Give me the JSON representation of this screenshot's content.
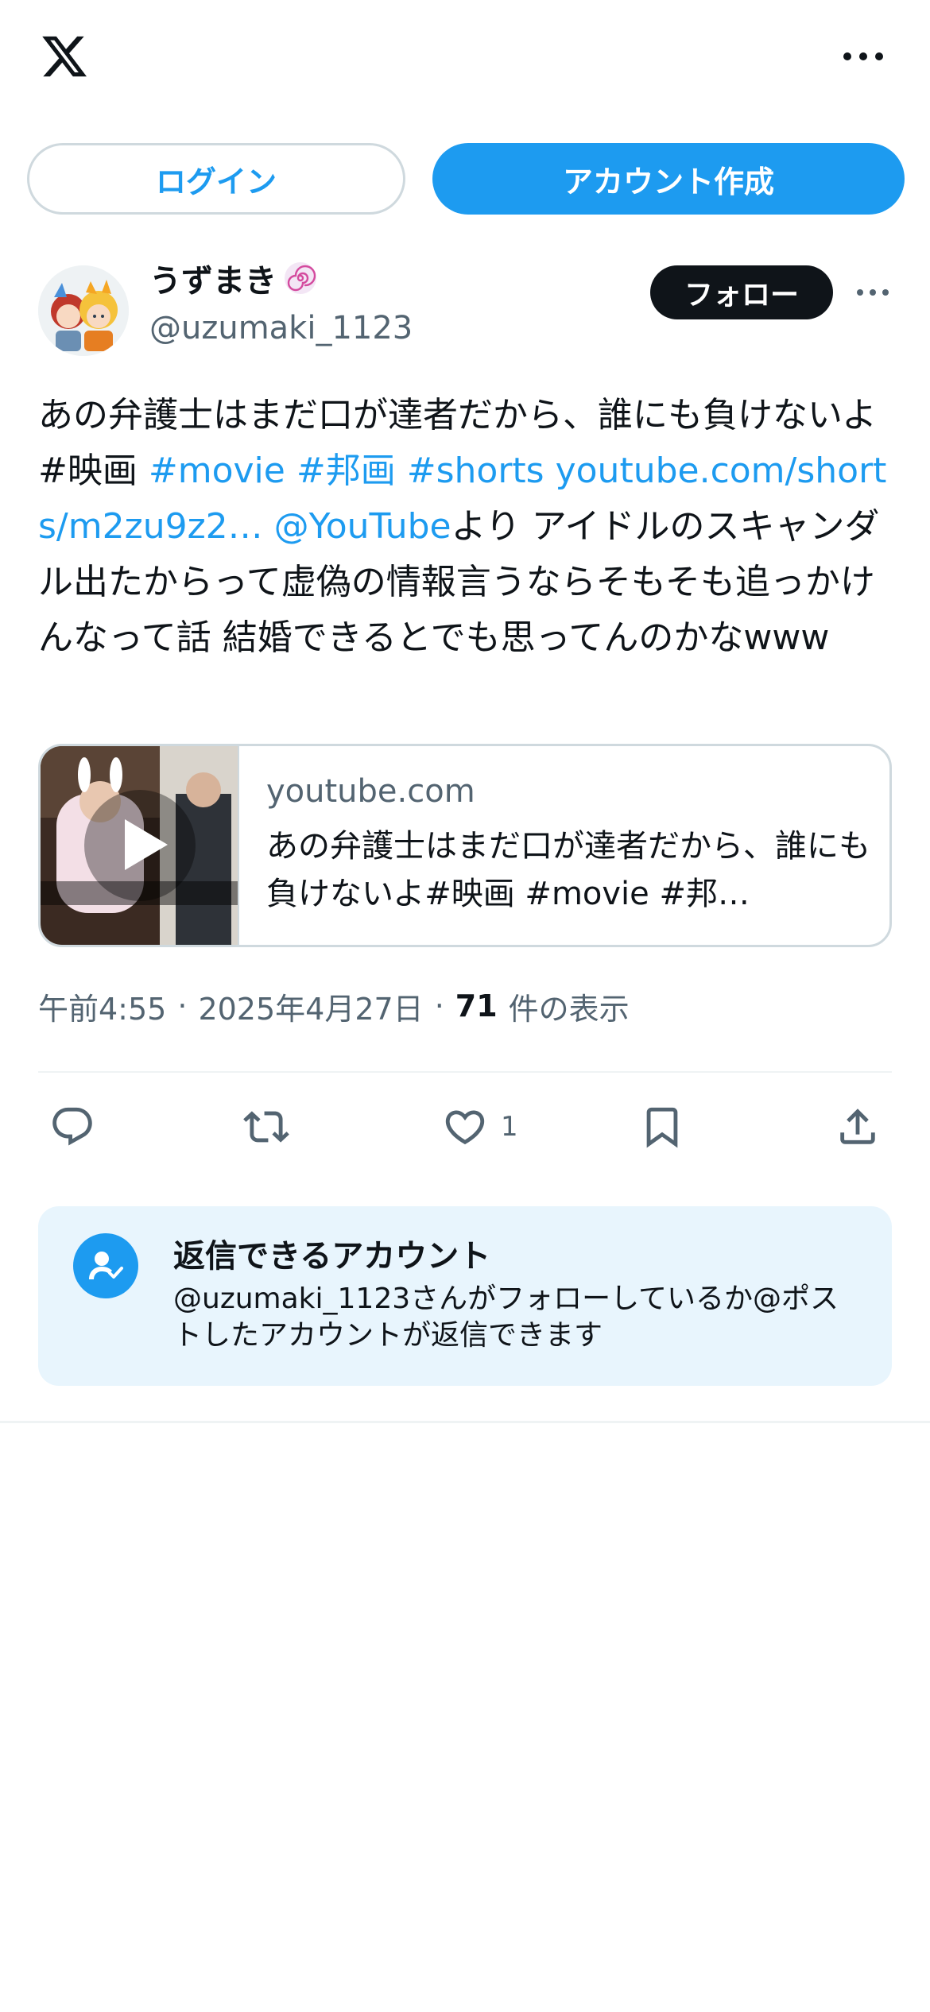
{
  "header": {
    "logo": "x-logo-icon",
    "more": "more-horizontal-icon"
  },
  "auth": {
    "login_label": "ログイン",
    "signup_label": "アカウント作成"
  },
  "author": {
    "display_name": "うずまき",
    "handle": "@uzumaki_1123",
    "follow_label": "フォロー"
  },
  "post": {
    "text_segments": [
      {
        "text": "あの弁護士はまだ口が達者だから、誰にも負けないよ#映画 ",
        "kind": "plain"
      },
      {
        "text": "#movie",
        "kind": "link"
      },
      {
        "text": " ",
        "kind": "plain"
      },
      {
        "text": "#邦画",
        "kind": "link"
      },
      {
        "text": " ",
        "kind": "plain"
      },
      {
        "text": "#shorts",
        "kind": "link"
      },
      {
        "text": " ",
        "kind": "plain"
      },
      {
        "text": "youtube.com/shorts/m2zu9z2…",
        "kind": "link"
      },
      {
        "text": " ",
        "kind": "plain"
      },
      {
        "text": "@YouTube",
        "kind": "link"
      },
      {
        "text": "より アイドルのスキャンダル出たからって虚偽の情報言うならそもそも追っかけんなって話 結婚できるとでも思ってんのかなwww",
        "kind": "plain"
      }
    ]
  },
  "card": {
    "domain": "youtube.com",
    "title": "あの弁護士はまだ口が達者だから、誰にも負けないよ#映画 #movie #邦…",
    "play_icon": "play-icon"
  },
  "meta": {
    "time": "午前4:55",
    "separator": "·",
    "date": "2025年4月27日",
    "views_count": "71",
    "views_label": "件の表示"
  },
  "actions": {
    "reply_icon": "reply-icon",
    "retweet_icon": "retweet-icon",
    "like_icon": "heart-icon",
    "like_count": "1",
    "bookmark_icon": "bookmark-icon",
    "share_icon": "share-icon"
  },
  "reply_settings": {
    "title": "返信できるアカウント",
    "body": "@uzumaki_1123さんがフォローしているか@ポストしたアカウントが返信できます"
  },
  "colors": {
    "accent": "#1d9bf0",
    "text": "#0f1419",
    "muted": "#536471",
    "border": "#cfd9de",
    "info_bg": "#e8f5fd"
  }
}
